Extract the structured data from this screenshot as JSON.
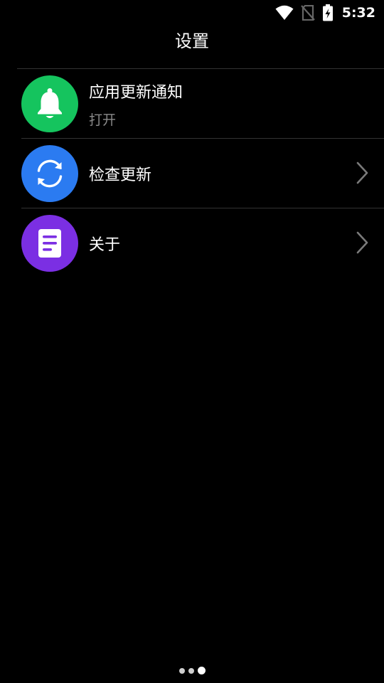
{
  "status_bar": {
    "time": "5:32",
    "icons": [
      "wifi-icon",
      "no-sim-icon",
      "battery-charging-icon"
    ]
  },
  "header": {
    "title": "设置"
  },
  "settings": {
    "items": [
      {
        "label": "应用更新通知",
        "sublabel": "打开",
        "icon": "bell-icon",
        "color": "#15C45E"
      },
      {
        "label": "检查更新",
        "icon": "sync-icon",
        "color": "#2B7BF1"
      },
      {
        "label": "关于",
        "icon": "document-icon",
        "color": "#7B2FE3"
      }
    ]
  },
  "page_indicator": {
    "count": 3,
    "active_index": 2
  },
  "colors": {
    "background": "#000000",
    "divider": "#333333",
    "secondary_text": "#8a8a8a"
  }
}
